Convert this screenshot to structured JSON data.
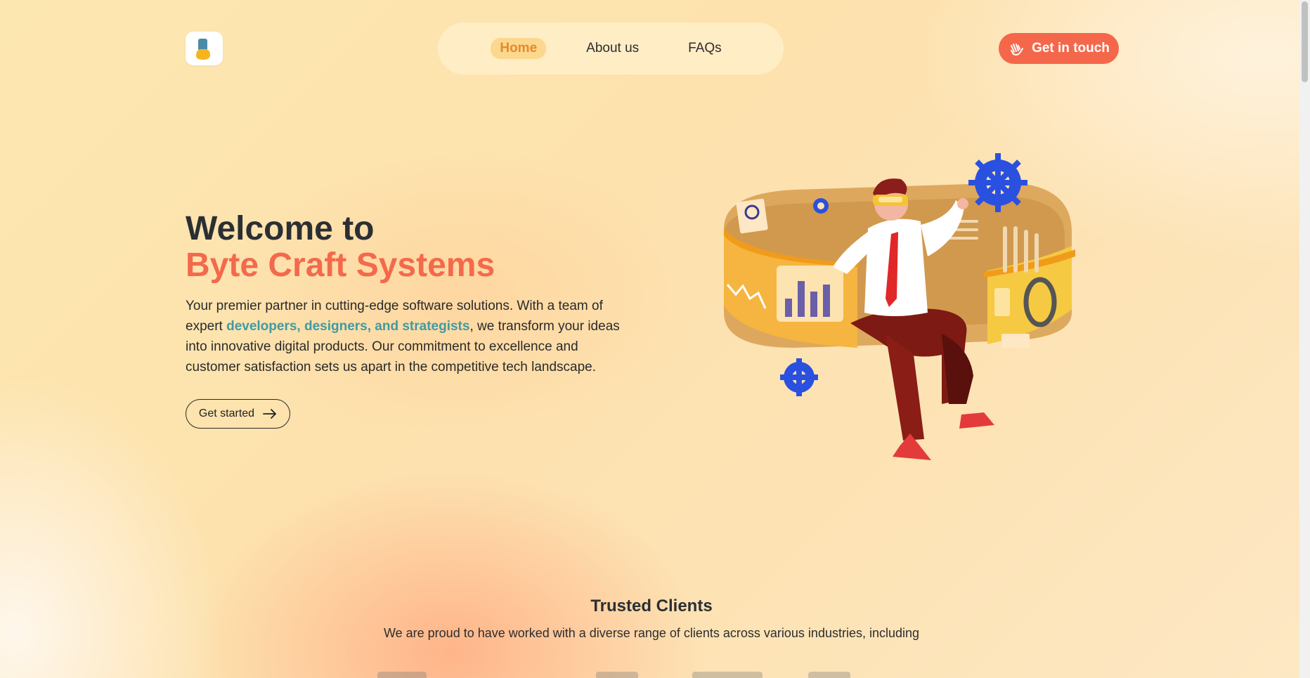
{
  "header": {
    "logo_icon": "brand-logo-icon",
    "nav": [
      {
        "label": "Home",
        "active": true
      },
      {
        "label": "About us",
        "active": false
      },
      {
        "label": "FAQs",
        "active": false
      }
    ],
    "cta_label": "Get in touch",
    "cta_icon": "waving-hand-icon"
  },
  "hero": {
    "title_line1": "Welcome to",
    "title_line2": "Byte Craft Systems",
    "desc_part1": "Your premier partner in cutting-edge software solutions. With a team of expert ",
    "desc_highlight": "developers, designers, and strategists",
    "desc_part2": ", we transform your ideas into innovative digital products. Our commitment to excellence and customer satisfaction sets us apart in the competitive tech landscape.",
    "button_label": "Get started",
    "button_icon": "arrow-right-icon"
  },
  "trusted": {
    "title": "Trusted Clients",
    "subtitle": "We are proud to have worked with a diverse range of clients across various industries, including"
  },
  "colors": {
    "accent": "#f4694c",
    "nav_active_bg": "#fcd88f",
    "nav_active_text": "#e58a2a",
    "highlight": "#3f9ba4"
  }
}
